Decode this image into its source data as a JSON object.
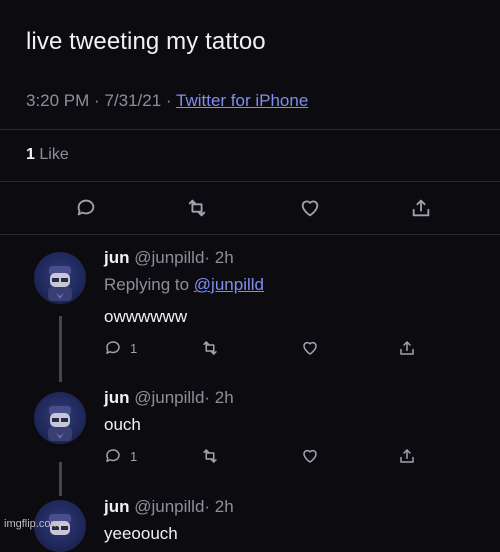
{
  "tweet": {
    "text": "live tweeting my tattoo",
    "time": "3:20 PM",
    "date": "7/31/21",
    "separator": "·",
    "client": "Twitter for iPhone",
    "likes_count": "1",
    "likes_label": "Like"
  },
  "icons": {
    "reply": "comment-bubble-icon",
    "retweet": "retweet-icon",
    "like": "heart-icon",
    "share": "share-upload-icon"
  },
  "replies": [
    {
      "display_name": "jun",
      "handle": "@junpilld",
      "age": "· 2h",
      "replying_to_label": "Replying to",
      "replying_to_handle": "@junpilld",
      "text": "owwwwww",
      "reply_count": "1"
    },
    {
      "display_name": "jun",
      "handle": "@junpilld",
      "age": "· 2h",
      "text": "ouch",
      "reply_count": "1"
    },
    {
      "display_name": "jun",
      "handle": "@junpilld",
      "age": "· 2h",
      "text": "yeeoouch"
    }
  ],
  "watermark": "imgflip.com",
  "colors": {
    "background": "#0c0c10",
    "link": "#7e8ef0",
    "muted": "#8c8f9a",
    "avatar": "#1b2250"
  }
}
